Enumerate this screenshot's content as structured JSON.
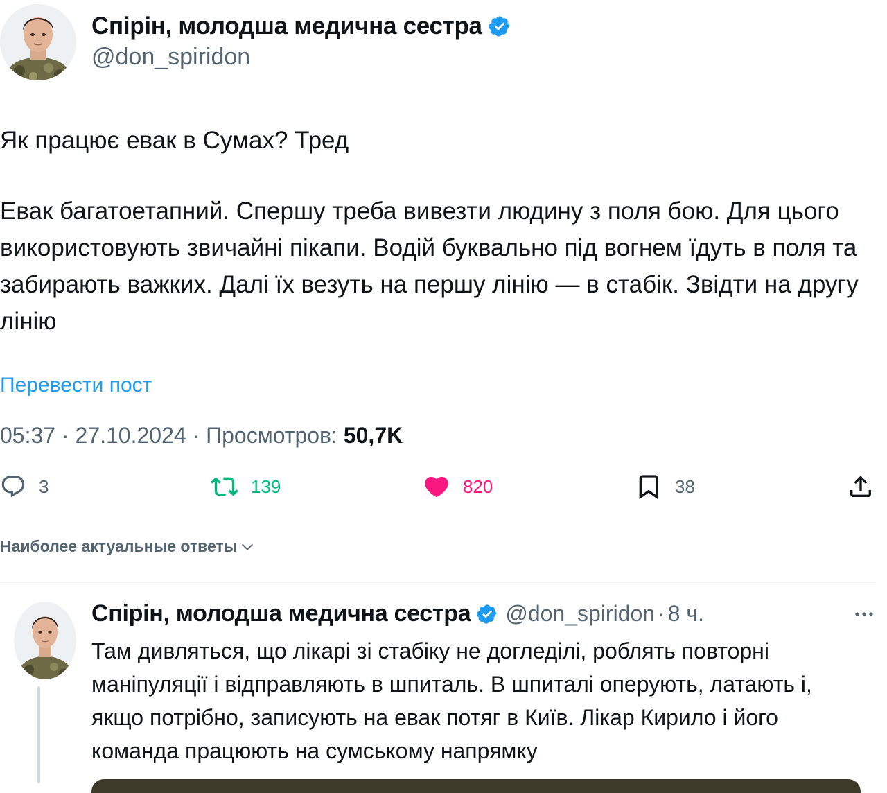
{
  "tweet": {
    "author_name": "Спірін, молодша медична сестра",
    "author_handle": "@don_spiridon",
    "paragraphs": [
      "Як працює евак в Сумах? Тред",
      "Евак багатоетапний. Спершу треба вивезти людину з поля бою. Для цього використовують звичайні пікапи. Водій буквально під вогнем їдуть в поля та забирають важких. Далі їх везуть на першу лінію — в стабік. Звідти на другу лінію"
    ],
    "translate_link": "Перевести пост",
    "time": "05:37",
    "date": "27.10.2024",
    "views_label": "Просмотров:",
    "views_count": "50,7K",
    "separator": "·"
  },
  "actions": {
    "replies": "3",
    "reposts": "139",
    "likes": "820",
    "bookmarks": "38"
  },
  "sort_label": "Наиболее актуальные ответы",
  "reply": {
    "author_name": "Спірін, молодша медична сестра",
    "author_handle": "@don_spiridon",
    "time_ago": "8 ч.",
    "text": "Там дивляться, що лікарі зі стабіку не догледілі, роблять повторні маніпуляції і відправляють в шпиталь. В шпиталі оперують, латають і, якщо потрібно, записують на евак потяг в Київ. Лікар Кирило і його команда працюють на сумському напрямку"
  },
  "colors": {
    "accent": "#1d9bf0",
    "repost": "#00ba7c",
    "like": "#f91880",
    "secondary_text": "#536471"
  },
  "icons": [
    "avatar",
    "verified-badge-icon",
    "reply-icon",
    "repost-icon",
    "like-icon",
    "bookmark-icon",
    "share-icon",
    "chevron-down-icon",
    "more-icon"
  ]
}
